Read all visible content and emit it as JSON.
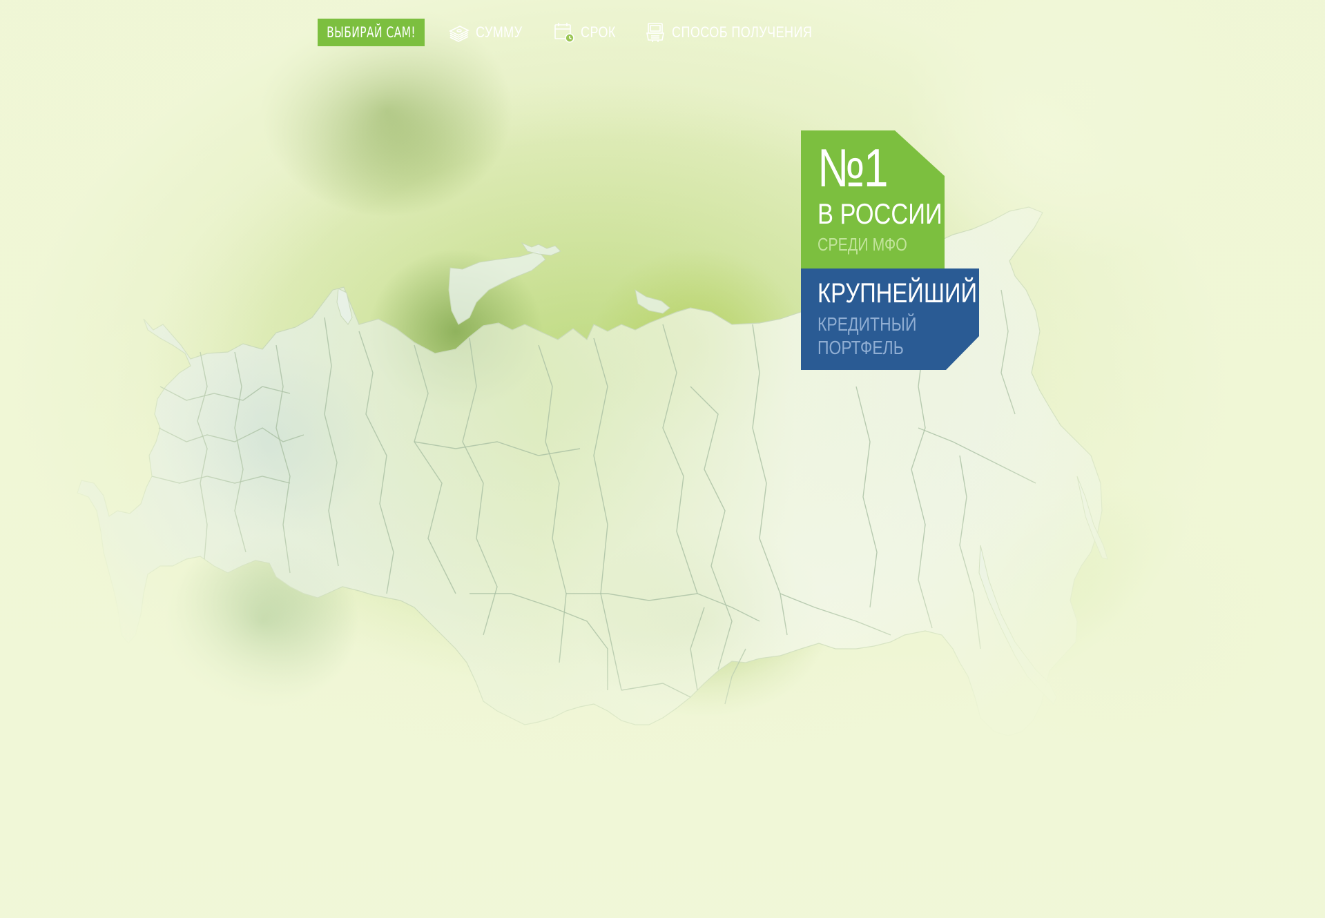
{
  "nav": {
    "cta_label": "ВЫБИРАЙ САМ!",
    "items": [
      {
        "label": "СУММУ",
        "icon": "money-stack-icon"
      },
      {
        "label": "СРОК",
        "icon": "calendar-clock-icon"
      },
      {
        "label": "СПОСОБ ПОЛУЧЕНИЯ",
        "icon": "payment-terminal-icon"
      }
    ]
  },
  "badge": {
    "number": "№1",
    "country": "В РОССИИ",
    "among": "СРЕДИ МФО",
    "largest": "КРУПНЕЙШИЙ",
    "credit": "КРЕДИТНЫЙ",
    "portfolio": "ПОРТФЕЛЬ"
  },
  "colors": {
    "accent_green": "#7cbf3f",
    "accent_blue": "#2a5b94",
    "map_fill": "#e9f1ee"
  }
}
